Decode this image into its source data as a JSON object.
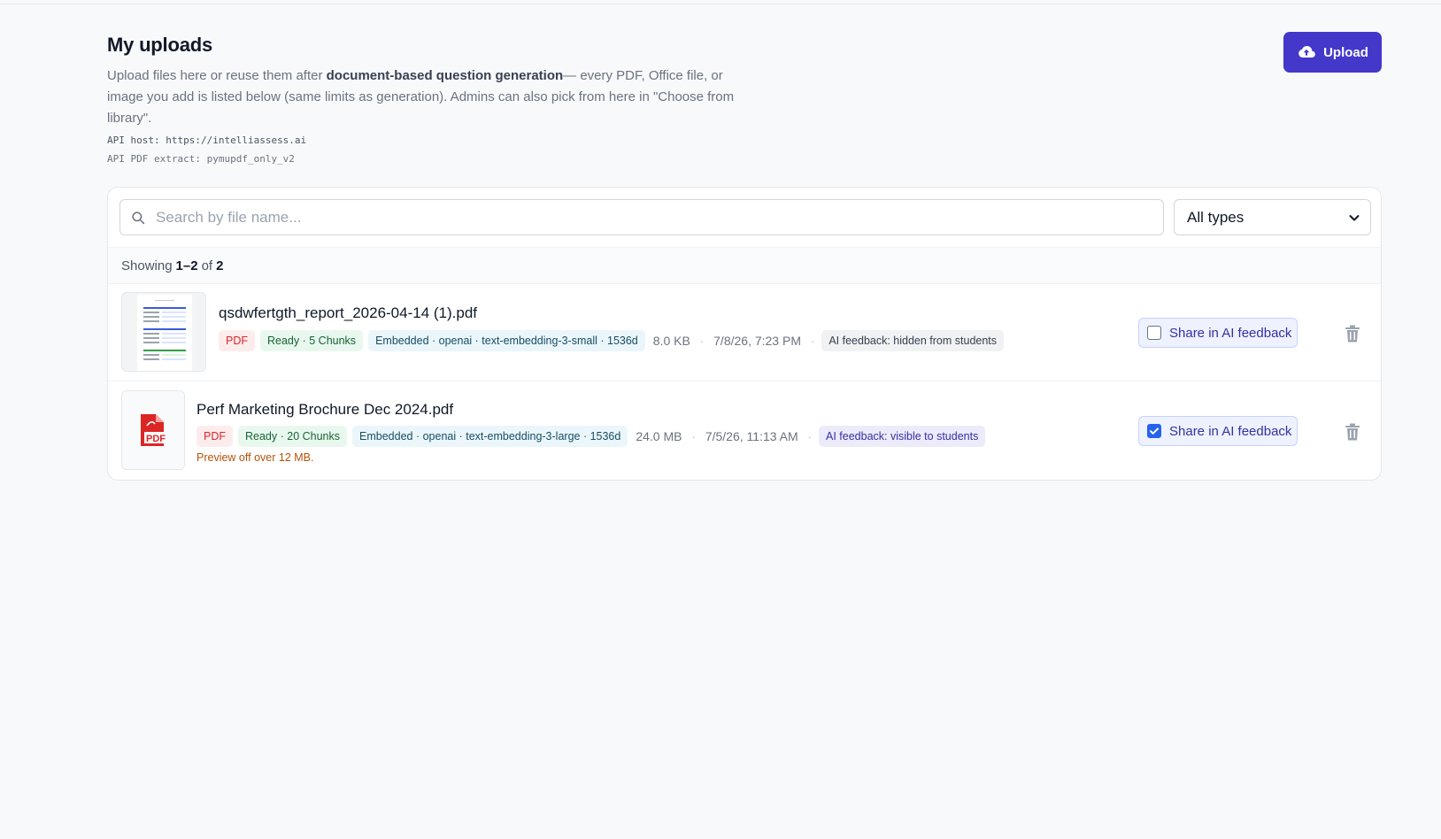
{
  "header": {
    "title": "My uploads",
    "intro_pre": "Upload files here or reuse them after ",
    "intro_bold": "document-based question generation",
    "intro_post": "— every PDF, Office file, or image you add is listed below (same limits as generation). Admins can also pick from here in \"Choose from library\".",
    "api_host_label": "API host:",
    "api_host_value": "https://intelliassess.ai",
    "api_pdf_label": "API PDF extract:",
    "api_pdf_value": "pymupdf_only_v2"
  },
  "toolbar": {
    "upload_label": "Upload",
    "upload_icon": "cloud-upload-icon"
  },
  "filters": {
    "search_placeholder": "Search by file name...",
    "search_value": "",
    "type_selected": "All types"
  },
  "listing": {
    "prefix": "Showing",
    "range": "1–2",
    "of": "of",
    "total": "2"
  },
  "files": [
    {
      "name": "qsdwfertgth_report_2026-04-14 (1).pdf",
      "type": "PDF",
      "status": "Ready · 5 Chunks",
      "embedding": "Embedded · openai · text-embedding-3-small · 1536d",
      "size": "8.0 KB",
      "date": "7/8/26, 7:23 PM",
      "feedback_badge": "AI feedback: hidden from students",
      "share_label": "Share in AI feedback",
      "share_checked": false,
      "thumbnail": "document-thumbnail"
    },
    {
      "name": "Perf Marketing Brochure Dec 2024.pdf",
      "type": "PDF",
      "status": "Ready · 20 Chunks",
      "embedding": "Embedded · openai · text-embedding-3-large · 1536d",
      "size": "24.0 MB",
      "date": "7/5/26, 11:13 AM",
      "feedback_badge": "AI feedback: visible to students",
      "share_label": "Share in AI feedback",
      "share_checked": true,
      "note": "Preview off over 12 MB.",
      "thumbnail": "pdf-file-icon"
    }
  ],
  "colors": {
    "accent": "#4338ca",
    "pdf_red": "#dc2626",
    "ready_green": "#166534",
    "warning": "#b45309"
  }
}
